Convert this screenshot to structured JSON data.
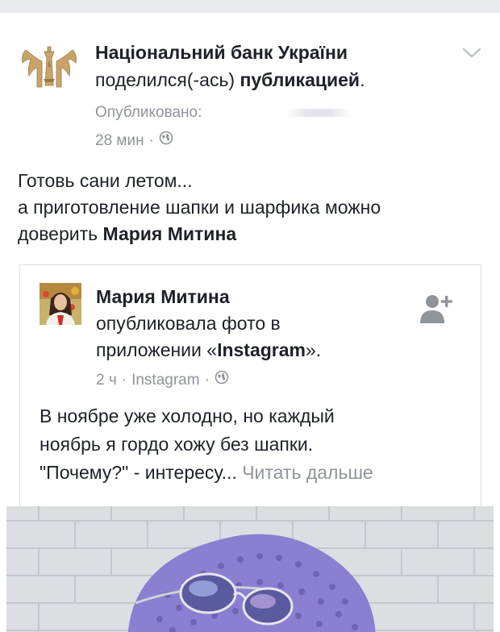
{
  "post": {
    "author_name": "Національний банк України",
    "action_text": "поделился(-ась)",
    "action_object": "публикацией",
    "action_end": ".",
    "published_label": "Опубликовано:",
    "time_ago": "28 мин",
    "separator": "·",
    "privacy_icon": "globe-icon",
    "options_icon": "chevron-down-icon",
    "text_line1": "Готовь сани летом...",
    "text_line2": "а приготовление шапки и шарфика можно",
    "text_line3_prefix": "доверить",
    "text_line3_mention": "Мария Митина"
  },
  "shared_post": {
    "author_name": "Мария Митина",
    "action_line1": "опубликовала фото в",
    "action_line2_prefix": "приложении «",
    "action_line2_app": "Instagram",
    "action_line2_suffix": "».",
    "time_ago": "2 ч",
    "separator": "·",
    "via": "Instagram",
    "privacy_icon": "globe-icon",
    "add_friend_icon": "add-friend-icon",
    "text_line1": "В ноябре уже холодно, но каждый",
    "text_line2": "ноябрь я гордо хожу без шапки.",
    "text_line3": "\"Почему?\" - интересу...",
    "read_more": "Читать дальше"
  },
  "colors": {
    "text": "#1d2129",
    "secondary": "#90949c",
    "border": "#dddfe2",
    "hat": "#8a7fd0"
  }
}
